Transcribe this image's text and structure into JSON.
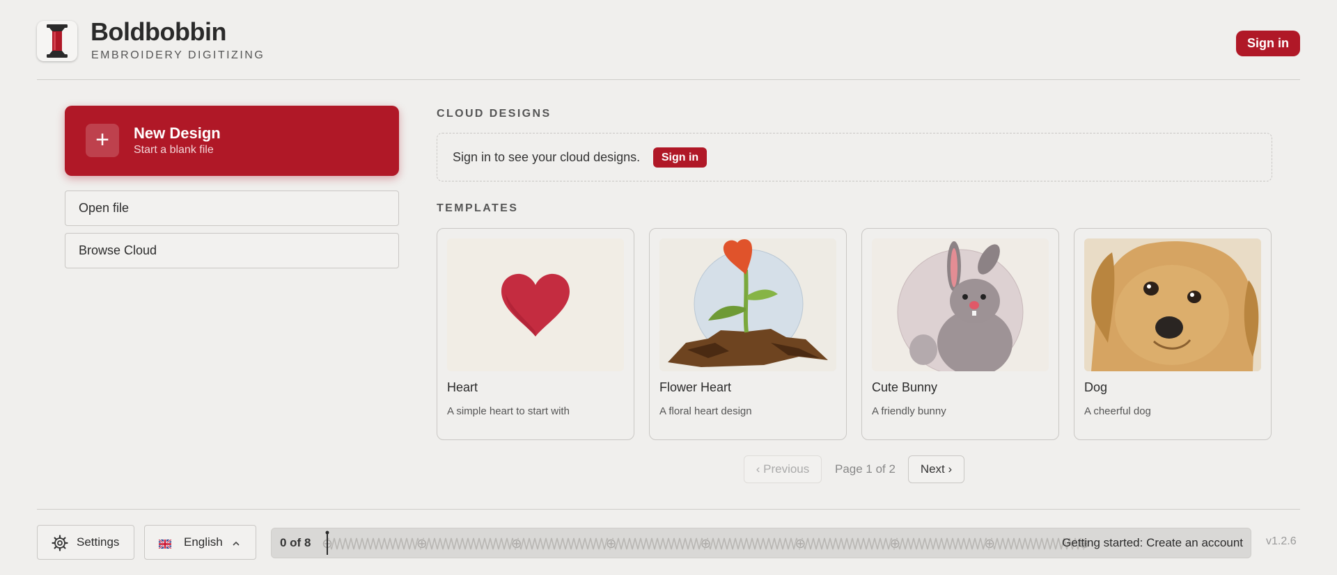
{
  "header": {
    "brand": "Boldbobbin",
    "subtitle": "EMBROIDERY DIGITIZING",
    "signin_label": "Sign in",
    "logo_icon": "spool-icon",
    "accent": "#b01827"
  },
  "sidebar": {
    "new_design": {
      "title": "New Design",
      "subtitle": "Start a blank file",
      "icon": "plus-icon"
    },
    "open_file_label": "Open file",
    "browse_cloud_label": "Browse Cloud"
  },
  "cloud": {
    "section_title": "CLOUD DESIGNS",
    "message": "Sign in to see your cloud designs.",
    "signin_label": "Sign in"
  },
  "templates": {
    "section_title": "TEMPLATES",
    "items": [
      {
        "title": "Heart",
        "desc": "A simple heart to start with",
        "icon": "heart-thumbnail"
      },
      {
        "title": "Flower Heart",
        "desc": "A floral heart design",
        "icon": "flower-heart-thumbnail"
      },
      {
        "title": "Cute Bunny",
        "desc": "A friendly bunny",
        "icon": "bunny-thumbnail"
      },
      {
        "title": "Dog",
        "desc": "A cheerful dog",
        "icon": "dog-thumbnail"
      }
    ],
    "pagination": {
      "prev_label": "‹ Previous",
      "page_info": "Page 1 of 2",
      "next_label": "Next ›"
    }
  },
  "footer": {
    "settings_label": "Settings",
    "language_label": "English",
    "progress": {
      "count": "0 of 8",
      "completed": 0,
      "total": 8,
      "label": "Getting started: Create an account"
    },
    "version": "v1.2.6"
  }
}
